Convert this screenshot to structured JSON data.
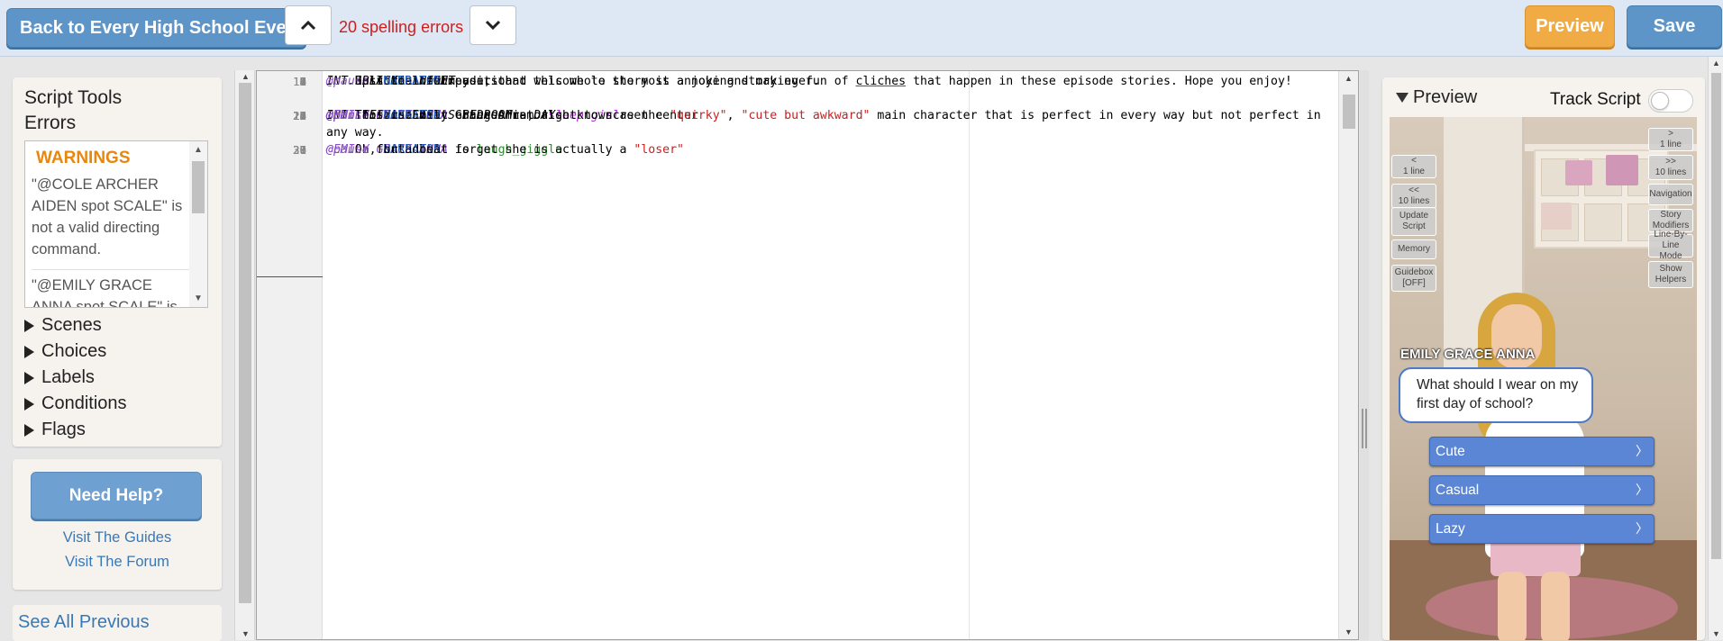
{
  "topbar": {
    "back_label": "Back to Every High School Ever",
    "spell_status": "20 spelling errors",
    "preview_label": "Preview",
    "save_label": "Save"
  },
  "sidebar": {
    "script_tools": "Script Tools",
    "errors": "Errors",
    "warnings_label": "WARNINGS",
    "warnings": [
      "\"@COLE ARCHER AIDEN spot SCALE\" is not a valid directing command.",
      "\"@EMILY GRACE ANNA spot SCALE\" is not a valid directing command."
    ],
    "sections": [
      "Scenes",
      "Choices",
      "Labels",
      "Conditions",
      "Flags"
    ],
    "help_button": "Need Help?",
    "guides_link": "Visit The Guides",
    "forum_link": "Visit The Forum",
    "see_all_previous": "See All Previous"
  },
  "editor": {
    "lines": [
      {
        "n": "1",
        "active": true,
        "segs": [
          {
            "c": "c-scene",
            "t": "INT. BLACK - NIGHT"
          }
        ]
      },
      {
        "n": "2",
        "segs": [
          {
            "c": "c-narr",
            "t": "        NARRATOR"
          }
        ]
      },
      {
        "n": "3",
        "segs": [
          {
            "c": "",
            "t": "    Episode 1 - Exposition"
          }
        ]
      },
      {
        "n": "4",
        "segs": []
      },
      {
        "n": "5",
        "segs": [
          {
            "c": "c-narr",
            "t": "        NARRATOR"
          }
        ]
      },
      {
        "n": "6",
        "segs": [
          {
            "c": "",
            "t": "    Hello fellow readers and welcome to the most annoying story ever."
          }
        ]
      },
      {
        "n": "7",
        "segs": []
      },
      {
        "n": "8",
        "segs": [
          {
            "c": "c-cmd",
            "t": "@pause"
          },
          {
            "c": "",
            "t": " for a beat"
          }
        ]
      },
      {
        "n": "9",
        "segs": []
      },
      {
        "n": "10",
        "segs": [
          {
            "c": "c-narr",
            "t": "        NARRATOR"
          }
        ]
      },
      {
        "n": "11",
        "wrap": true,
        "segs": [
          {
            "c": "",
            "t": "    Just to inform you, that this whole story is a joke and making fun of "
          },
          {
            "c": "c-err",
            "t": "cliches"
          },
          {
            "c": "",
            "t": " that happen in these episode stories. Hope you enjoy!"
          }
        ]
      },
      {
        "n": "12",
        "segs": []
      },
      {
        "n": "13",
        "segs": [
          {
            "c": "c-cmd",
            "t": "@pause"
          },
          {
            "c": "",
            "t": " for a beat"
          }
        ]
      },
      {
        "n": "14",
        "segs": []
      },
      {
        "n": "15",
        "segs": [
          {
            "c": "c-scene",
            "t": "INT. TEEN SISTER'S BEDROOM - DAY"
          }
        ]
      },
      {
        "n": "16",
        "segs": [
          {
            "c": "c-cmd",
            "t": "@EMILY GRACE ANNA"
          },
          {
            "c": "",
            "t": " changes into "
          },
          {
            "c": "c-anim",
            "t": "sleep girl"
          }
        ]
      },
      {
        "n": "17",
        "segs": [
          {
            "c": "c-cmd",
            "t": "@EMILY GRACE ANNA"
          },
          {
            "c": "",
            "t": " enters from right to screen center"
          }
        ]
      },
      {
        "n": "18",
        "segs": [
          {
            "c": "c-cmd",
            "t": "@pan"
          },
          {
            "c": "",
            "t": " to zone 2"
          }
        ]
      },
      {
        "n": "19",
        "segs": [
          {
            "c": "c-cmd",
            "t": "@pause"
          },
          {
            "c": "",
            "t": " for a beat"
          }
        ]
      },
      {
        "n": "20",
        "segs": []
      },
      {
        "n": "21",
        "segs": [
          {
            "c": "c-cmd",
            "t": "@pan"
          },
          {
            "c": "",
            "t": " to zone 1"
          }
        ]
      },
      {
        "n": "22",
        "segs": []
      },
      {
        "n": "23",
        "segs": []
      },
      {
        "n": "24",
        "segs": [
          {
            "c": "c-narr",
            "t": "        NARRATOR"
          }
        ]
      },
      {
        "n": "25",
        "wrap": true,
        "segs": [
          {
            "c": "",
            "t": "    This is Emily Grace Anna, also known as the "
          },
          {
            "c": "c-str",
            "t": "\"quirky\""
          },
          {
            "c": "",
            "t": ", "
          },
          {
            "c": "c-str",
            "t": "\"cute but awkward\""
          },
          {
            "c": "",
            "t": " main character that is perfect in every way but not perfect in any way."
          }
        ]
      },
      {
        "n": "26",
        "segs": []
      },
      {
        "n": "27",
        "segs": [
          {
            "c": "c-cmd",
            "t": "@EMILY GRACE ANNA"
          },
          {
            "c": "",
            "t": " is "
          },
          {
            "c": "c-green",
            "t": "laugh_giggle"
          }
        ]
      },
      {
        "n": "28",
        "segs": []
      },
      {
        "n": "29",
        "segs": [
          {
            "c": "c-narr",
            "t": "        NARRATOR"
          }
        ]
      },
      {
        "n": "30",
        "segs": [
          {
            "c": "",
            "t": "    Oh, but don't forget she is actually a "
          },
          {
            "c": "c-str",
            "t": "\"loser\""
          }
        ]
      },
      {
        "n": "31",
        "segs": [
          {
            "c": "c-cmd",
            "t": "@pause"
          },
          {
            "c": "",
            "t": " for a beat"
          }
        ]
      }
    ]
  },
  "preview": {
    "title": "Preview",
    "track_script": "Track Script",
    "track_enabled": false,
    "left_buttons": [
      {
        "name": "back-1-line-button",
        "lines": [
          "<",
          "1 line"
        ]
      },
      {
        "name": "back-10-lines-button",
        "lines": [
          "<<",
          "10 lines"
        ]
      },
      {
        "name": "update-script-button",
        "lines": [
          "Update",
          "Script"
        ]
      },
      {
        "name": "memory-button",
        "lines": [
          "Memory"
        ]
      },
      {
        "name": "guidebox-button",
        "lines": [
          "Guidebox",
          "[OFF]"
        ]
      }
    ],
    "right_buttons": [
      {
        "name": "forward-1-line-button",
        "lines": [
          ">",
          "1 line"
        ]
      },
      {
        "name": "forward-10-lines-button",
        "lines": [
          ">>",
          "10 lines"
        ]
      },
      {
        "name": "navigation-button",
        "lines": [
          "Navigation"
        ]
      },
      {
        "name": "story-modifiers-button",
        "lines": [
          "Story",
          "Modifiers"
        ]
      },
      {
        "name": "line-by-line-mode-button",
        "lines": [
          "Line-By-Line",
          "Mode"
        ]
      },
      {
        "name": "show-helpers-button",
        "lines": [
          "Show",
          "Helpers"
        ]
      }
    ],
    "speaker": "EMILY GRACE ANNA",
    "dialogue": "What should I wear on my first day of school?",
    "choices": [
      "Cute",
      "Casual",
      "Lazy"
    ],
    "colors": {
      "choice": "#5a86d5",
      "preview_button": "#f0ab45",
      "save_button": "#5d95c8"
    }
  }
}
